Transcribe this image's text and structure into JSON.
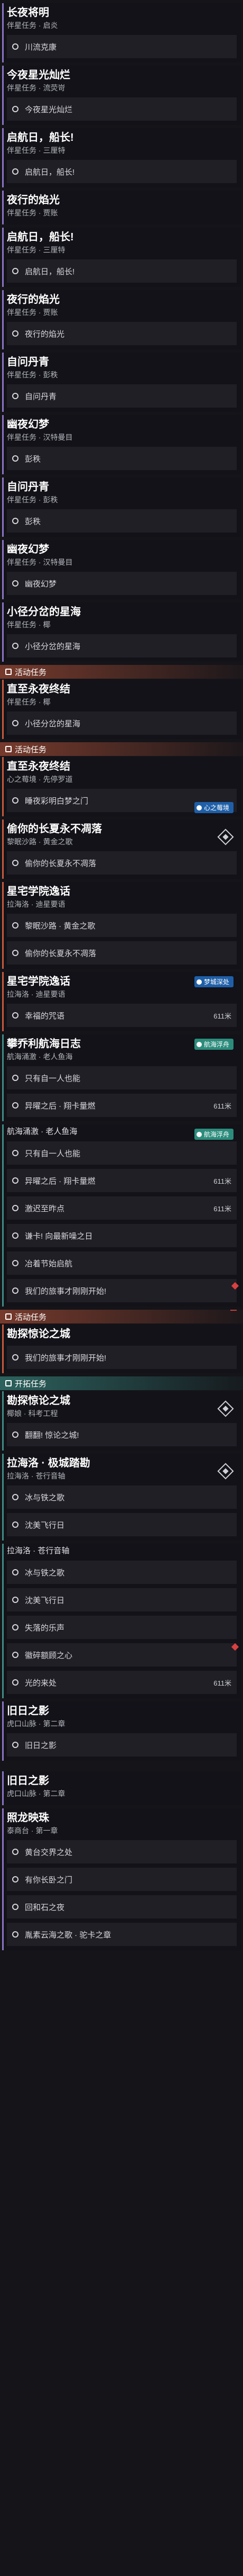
{
  "sections": {
    "activity": "活动任务",
    "companion": "伴星任务",
    "trailblaze": "开拓任务"
  },
  "badges": {
    "heart": "心之莓境",
    "dream": "梦城深处",
    "sea": "航海浮舟"
  },
  "distances": {
    "d611": "611米"
  },
  "cards": [
    {
      "title": "长夜将明",
      "sub": "伴星任务 · 启炎",
      "steps": [
        "川流克康"
      ]
    },
    {
      "title": "今夜星光灿烂",
      "sub": "伴星任务 · 流荧岢",
      "steps": [
        "今夜星光灿烂"
      ]
    },
    {
      "title": "启航日，船长!",
      "sub": "伴星任务 · 三厘特",
      "steps": [
        "启航日，船长!"
      ]
    },
    {
      "title": "夜行的焰光",
      "sub": "伴星任务 · 贾账",
      "steps": []
    },
    {
      "title": "启航日，船长!",
      "sub": "伴星任务 · 三厘特",
      "steps": [
        "启航日，船长!"
      ]
    },
    {
      "title": "夜行的焰光",
      "sub": "伴星任务 · 贾账",
      "steps": [
        "夜行的焰光"
      ]
    },
    {
      "title": "自问丹青",
      "sub": "伴星任务 · 彭秩",
      "steps": [
        "自问丹青"
      ]
    },
    {
      "title": "幽夜幻梦",
      "sub": "伴星任务 · 汉特曼目",
      "steps": [
        "彭秩"
      ]
    },
    {
      "title": "自问丹青",
      "sub": "伴星任务 · 彭秩",
      "steps": [
        "彭秩"
      ]
    },
    {
      "title": "幽夜幻梦",
      "sub": "伴星任务 · 汉特曼目",
      "steps": [
        "幽夜幻梦"
      ]
    },
    {
      "title": "小径分岔的星海",
      "sub": "伴星任务 · 椰",
      "steps": [
        "小径分岔的星海"
      ]
    },
    {
      "title": "直至永夜终结",
      "sub": "伴星任务 · 椰",
      "steps": [
        "小径分岔的星海"
      ]
    },
    {
      "title": "直至永夜终结",
      "sub": "心之莓境 · 先停罗道",
      "steps": [
        "睡夜彩明白梦之门"
      ]
    },
    {
      "title": "偷你的长夏永不凋落",
      "sub": "黎眠沙路 · 黄金之歌",
      "steps": [
        "偷你的长夏永不凋落"
      ]
    },
    {
      "title": "星宅学院逸话",
      "sub": "拉海洛 · 迪星要语",
      "steps": [
        "黎眠沙路 · 黄金之歌",
        "偷你的长夏永不凋落"
      ]
    },
    {
      "title": "星宅学院逸话",
      "sub": "拉海洛 · 迪星要语",
      "steps": [
        "幸福的咒语"
      ]
    },
    {
      "title": "攀乔利航海日志",
      "sub": "航海涌激 · 老人鱼海",
      "steps": [
        "只有自一人也能",
        "异曜之后 · 翔卡量燃"
      ]
    },
    {
      "title": "航海涌激 · 老人鱼海",
      "sub": "",
      "steps": [
        "只有自一人也能",
        "异曜之后 · 翔卡量燃",
        "激迟至昨点",
        "谦卡! 向最新噪之日",
        "冶着节始启航",
        "我们的旅事才刚刚开始!"
      ]
    },
    {
      "title": "勘探惊论之城",
      "sub": "",
      "steps": [
        "我们的旅事才刚刚开始!"
      ]
    },
    {
      "title": "勘探惊论之城",
      "sub": "椰娘 · 科考工程",
      "steps": [
        "翻翻! 惊论之城!"
      ]
    },
    {
      "title": "拉海洛 · 极城踏勘",
      "sub": "拉海洛 · 苍行音轴",
      "steps": [
        "冰与铁之歌",
        "沈美飞行日"
      ]
    },
    {
      "title": "拉海洛 · 苍行音轴",
      "sub": "",
      "steps": [
        "冰与铁之歌",
        "沈美飞行日",
        "失落的乐声",
        "徽碎额顾之心",
        "光的来处"
      ]
    },
    {
      "title": "旧日之影",
      "sub": "虎口山脉 · 第二章",
      "steps": [
        "旧日之影"
      ]
    },
    {
      "title": "旧日之影",
      "sub": "虎口山脉 · 第二章",
      "steps": []
    },
    {
      "title": "照龙映珠",
      "sub": "泰商台 · 第一章",
      "steps": [
        "黄台交界之处",
        "有你长卧之门",
        "回和石之夜",
        "胤素云海之歌 · 驼卡之章"
      ]
    }
  ]
}
